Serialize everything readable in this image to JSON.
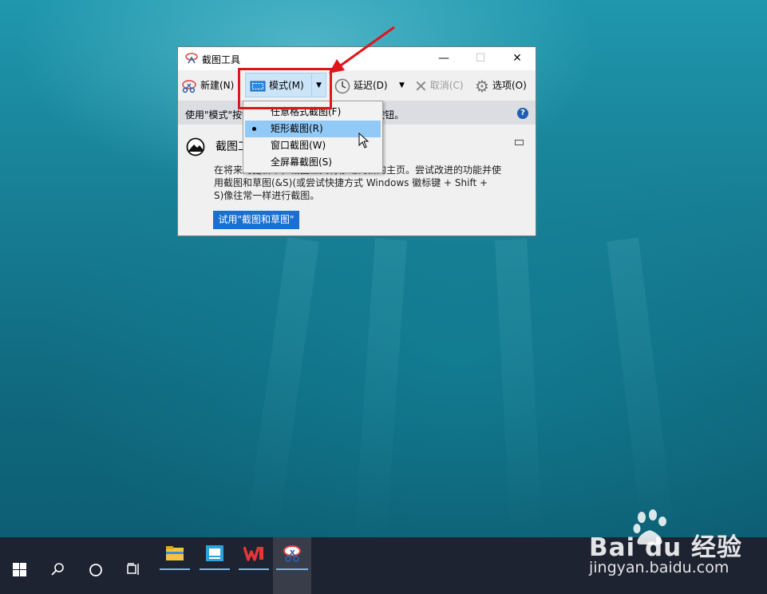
{
  "window": {
    "title": "截图工具",
    "controls": {
      "minimize": "—",
      "maximize": "☐",
      "close": "✕"
    }
  },
  "toolbar": {
    "new_label": "新建(N)",
    "mode_label": "模式(M)",
    "delay_label": "延迟(D)",
    "cancel_label": "取消(C)",
    "options_label": "选项(O)"
  },
  "infobar": {
    "text": "使用\"模式\"按钮选择截图类型，或单击\"新建\"按钮。",
    "help_label": "?"
  },
  "content": {
    "heading": "截图工具正在移动...",
    "lines": [
      "在将来的更新中，截图工具将移动到新的主页。尝试改进的功能并使",
      "用截图和草图(&S)(或尝试快捷方式 Windows 徽标键 + Shift +",
      "S)像往常一样进行截图。"
    ],
    "try_button": "试用\"截图和草图\""
  },
  "mode_menu": {
    "items": [
      {
        "label": "任意格式截图(F)",
        "selected": false
      },
      {
        "label": "矩形截图(R)",
        "selected": true
      },
      {
        "label": "窗口截图(W)",
        "selected": false
      },
      {
        "label": "全屏幕截图(S)",
        "selected": false
      }
    ]
  },
  "taskbar": {
    "icons": [
      "windows-start-icon",
      "search-icon",
      "cortana-icon",
      "task-view-icon",
      "file-explorer-icon",
      "app-icon",
      "wps-office-icon",
      "snipping-tool-icon"
    ]
  },
  "watermark": {
    "brand": "Bai du 经验",
    "url": "jingyan.baidu.com"
  },
  "colors": {
    "accent": "#1a6fd1",
    "annotation": "#e0151b",
    "menu_highlight": "#91c9f7"
  }
}
